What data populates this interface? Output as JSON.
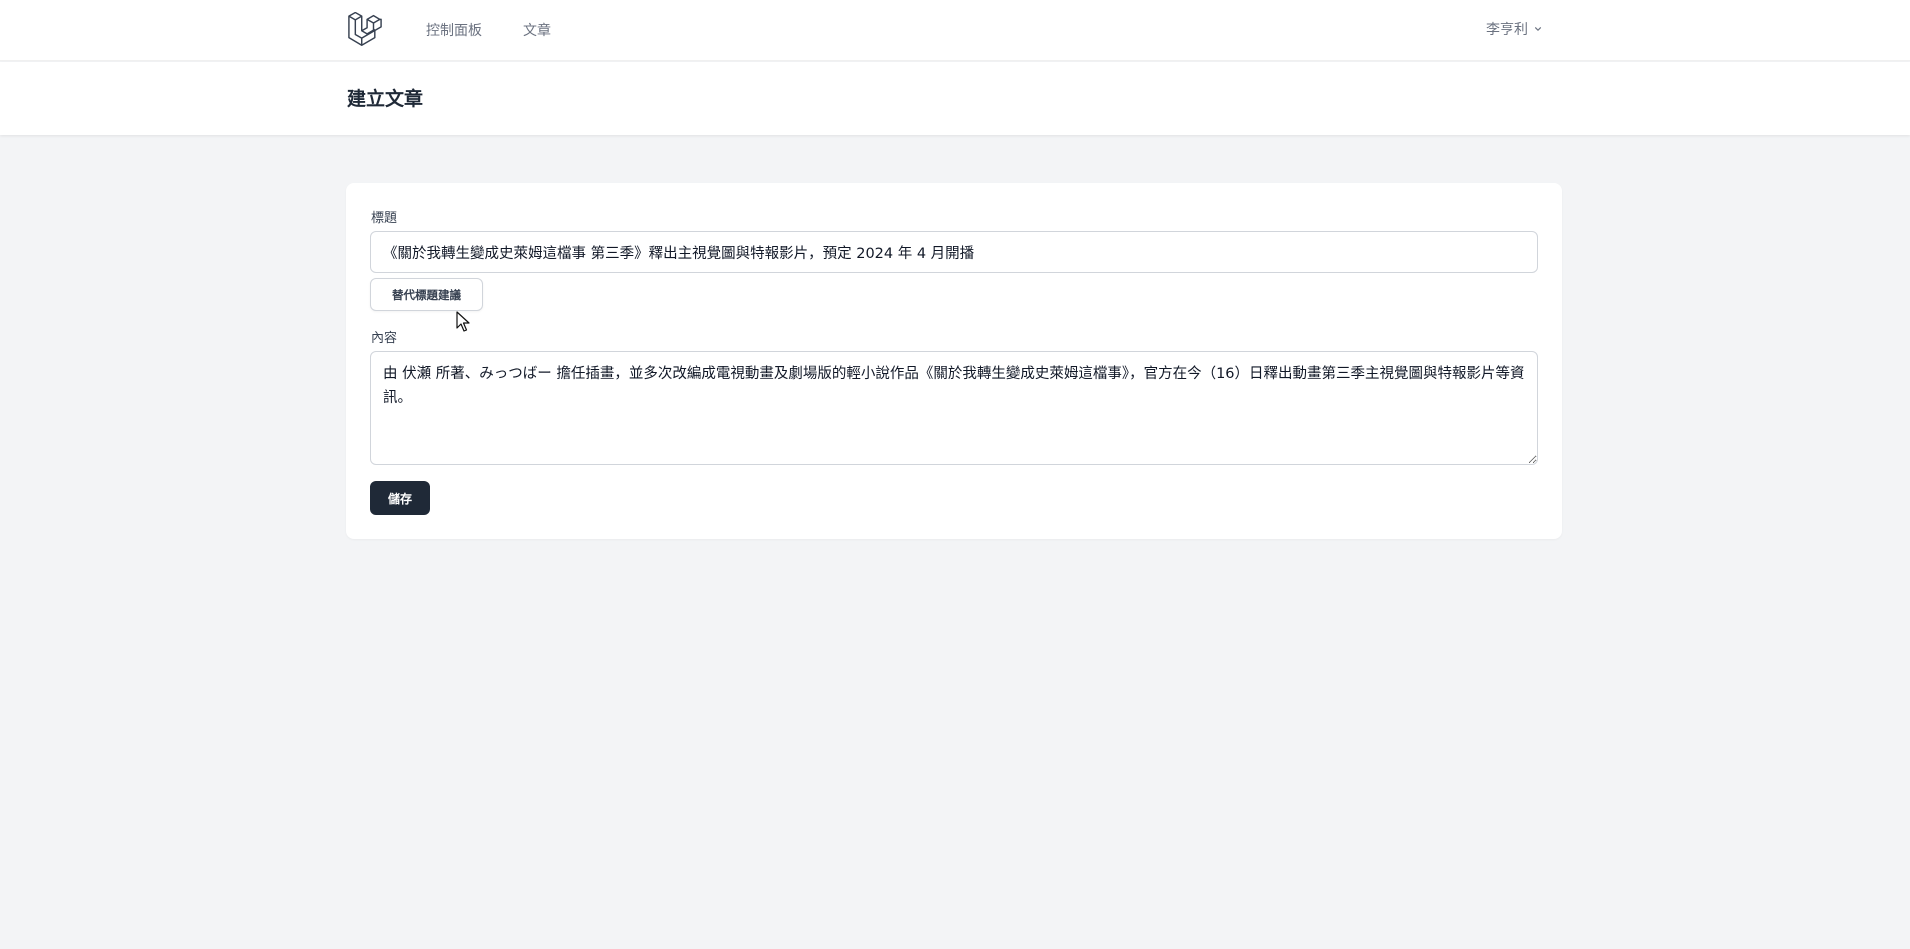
{
  "nav": {
    "logo_icon": "laravel-logo-icon",
    "links": [
      "控制面板",
      "文章"
    ],
    "user_name": "李亨利",
    "user_menu_icon": "chevron-down-icon"
  },
  "header": {
    "title": "建立文章"
  },
  "form": {
    "title_label": "標題",
    "title_value": "《關於我轉生變成史萊姆這檔事 第三季》釋出主視覺圖與特報影片，預定 2024 年 4 月開播",
    "suggest_button": "替代標題建議",
    "content_label": "內容",
    "content_value": "由 伏瀬 所著、みっつばー 擔任插畫，並多次改編成電視動畫及劇場版的輕小說作品《關於我轉生變成史萊姆這檔事》，官方在今（16）日釋出動畫第三季主視覺圖與特報影片等資訊。",
    "save_button": "儲存"
  },
  "colors": {
    "page_bg": "#f3f4f6",
    "card_bg": "#ffffff",
    "primary_button": "#1f2937",
    "muted_text": "#6b7280"
  }
}
